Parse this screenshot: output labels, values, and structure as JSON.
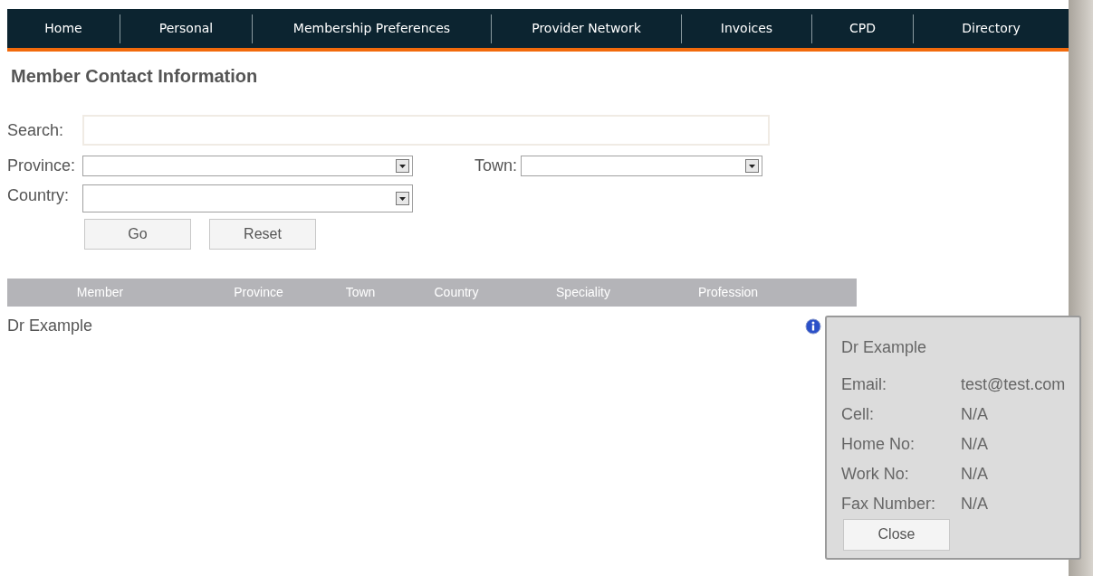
{
  "nav": [
    {
      "label": "Home"
    },
    {
      "label": "Personal"
    },
    {
      "label": "Membership Preferences"
    },
    {
      "label": "Provider Network"
    },
    {
      "label": "Invoices"
    },
    {
      "label": "CPD"
    },
    {
      "label": "Directory"
    }
  ],
  "title": "Member Contact Information",
  "search": {
    "label": "Search:"
  },
  "province": {
    "label": "Province:"
  },
  "town": {
    "label": "Town:"
  },
  "country": {
    "label": "Country:"
  },
  "buttons": [
    "Go",
    "Reset"
  ],
  "table": {
    "columns": [
      "Member",
      "Province",
      "Town",
      "Country",
      "Speciality",
      "Profession"
    ],
    "rows": [
      {
        "member": "Dr Example"
      }
    ]
  },
  "popup": {
    "name": "Dr Example",
    "fields": [
      {
        "label": "Email:",
        "value": "test@test.com"
      },
      {
        "label": "Cell:",
        "value": "N/A"
      },
      {
        "label": "Home No:",
        "value": "N/A"
      },
      {
        "label": "Work No:",
        "value": "N/A"
      },
      {
        "label": "Fax Number:",
        "value": "N/A"
      }
    ],
    "button": "Close"
  }
}
